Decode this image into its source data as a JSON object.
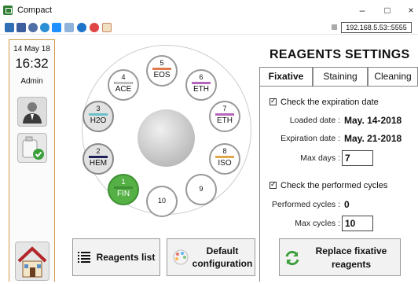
{
  "window": {
    "title": "Compact",
    "minimize_glyph": "–",
    "maximize_glyph": "□",
    "close_glyph": "×"
  },
  "toolbar": {
    "icons": [
      "network-icon",
      "frame-icon",
      "settings-icon",
      "refresh-icon",
      "windows-icon",
      "image-icon",
      "info-icon",
      "stop-icon",
      "hourglass-icon"
    ],
    "ip_address": "192.168.5.53::5555"
  },
  "left_panel": {
    "date": "14 May 18",
    "time": "16:32",
    "user": "Admin"
  },
  "carousel": {
    "slots": [
      {
        "number": "1",
        "label": "FIN",
        "color": "#3f8f34",
        "state": "active"
      },
      {
        "number": "2",
        "label": "HEM",
        "color": "#1f1f5a",
        "state": "filled"
      },
      {
        "number": "3",
        "label": "H2O",
        "color": "#69c0c8",
        "state": "filled"
      },
      {
        "number": "4",
        "label": "ACE",
        "color": "#ffffff",
        "state": "empty"
      },
      {
        "number": "5",
        "label": "EOS",
        "color": "#e07a4a",
        "state": "empty"
      },
      {
        "number": "6",
        "label": "ETH",
        "color": "#b466b8",
        "state": "empty"
      },
      {
        "number": "7",
        "label": "ETH",
        "color": "#b466b8",
        "state": "empty"
      },
      {
        "number": "8",
        "label": "ISO",
        "color": "#e0a84a",
        "state": "empty"
      },
      {
        "number": "9",
        "label": "",
        "color": "",
        "state": "empty"
      },
      {
        "number": "10",
        "label": "",
        "color": "",
        "state": "empty"
      }
    ]
  },
  "buttons": {
    "reagents_list": "Reagents list",
    "default_config_line1": "Default",
    "default_config_line2": "configuration",
    "replace_line1": "Replace fixative",
    "replace_line2": "reagents"
  },
  "settings": {
    "title": "REAGENTS SETTINGS",
    "tabs": [
      "Fixative",
      "Staining",
      "Cleaning"
    ],
    "active_tab": "Fixative",
    "check_expiration_label": "Check the expiration date",
    "loaded_date_label": "Loaded date :",
    "loaded_date_value": "May. 14-2018",
    "expiration_date_label": "Expiration date :",
    "expiration_date_value": "May. 21-2018",
    "max_days_label": "Max days :",
    "max_days_value": "7",
    "check_cycles_label": "Check the performed cycles",
    "performed_cycles_label": "Performed cycles :",
    "performed_cycles_value": "0",
    "max_cycles_label": "Max cycles :",
    "max_cycles_value": "10"
  }
}
